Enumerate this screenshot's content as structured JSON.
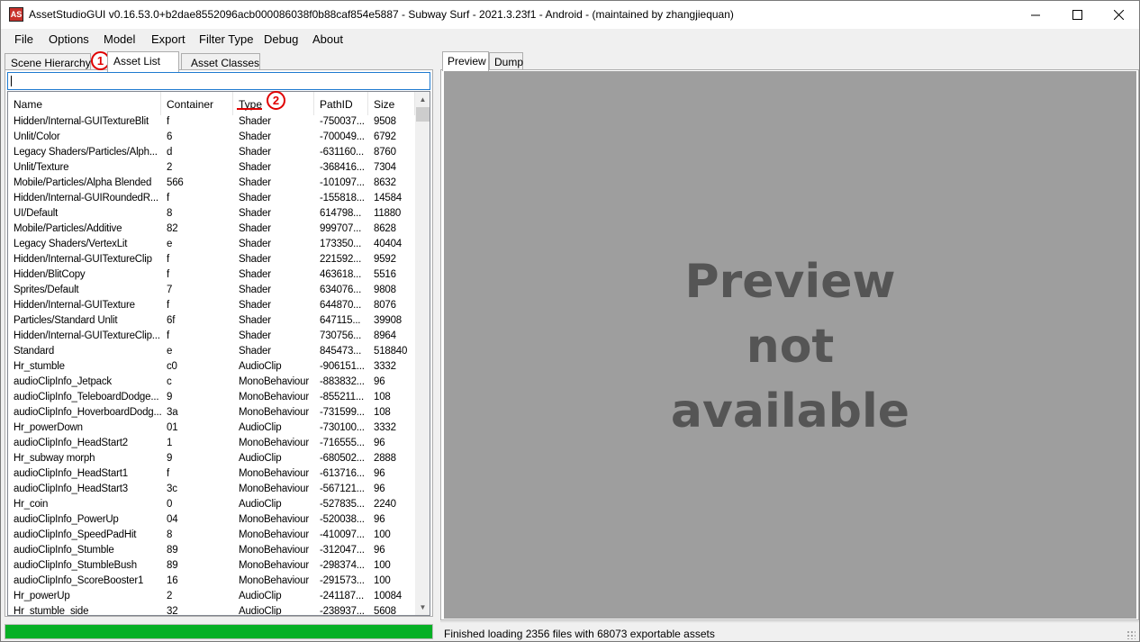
{
  "window": {
    "title": "AssetStudioGUI v0.16.53.0+b2dae8552096acb000086038f0b88caf854e5887 - Subway Surf - 2021.3.23f1 - Android - (maintained by zhangjiequan)",
    "icon_text": "AS"
  },
  "menu": [
    "File",
    "Options",
    "Model",
    "Export",
    "Filter Type",
    "Debug",
    "About"
  ],
  "left_tabs": [
    "Scene Hierarchy",
    "Asset List",
    "Asset Classes"
  ],
  "filter": {
    "value": ""
  },
  "columns": [
    "Name",
    "Container",
    "Type",
    "PathID",
    "Size"
  ],
  "rows": [
    [
      "Hidden/Internal-GUITextureBlit",
      "f",
      "Shader",
      "-750037...",
      "9508"
    ],
    [
      "Unlit/Color",
      "6",
      "Shader",
      "-700049...",
      "6792"
    ],
    [
      "Legacy Shaders/Particles/Alph...",
      "d",
      "Shader",
      "-631160...",
      "8760"
    ],
    [
      "Unlit/Texture",
      "2",
      "Shader",
      "-368416...",
      "7304"
    ],
    [
      "Mobile/Particles/Alpha Blended",
      "566",
      "Shader",
      "-101097...",
      "8632"
    ],
    [
      "Hidden/Internal-GUIRoundedR...",
      "f",
      "Shader",
      "-155818...",
      "14584"
    ],
    [
      "UI/Default",
      "8",
      "Shader",
      "614798...",
      "11880"
    ],
    [
      "Mobile/Particles/Additive",
      "82",
      "Shader",
      "999707...",
      "8628"
    ],
    [
      "Legacy Shaders/VertexLit",
      "e",
      "Shader",
      "173350...",
      "40404"
    ],
    [
      "Hidden/Internal-GUITextureClip",
      "f",
      "Shader",
      "221592...",
      "9592"
    ],
    [
      "Hidden/BlitCopy",
      "f",
      "Shader",
      "463618...",
      "5516"
    ],
    [
      "Sprites/Default",
      "7",
      "Shader",
      "634076...",
      "9808"
    ],
    [
      "Hidden/Internal-GUITexture",
      "f",
      "Shader",
      "644870...",
      "8076"
    ],
    [
      "Particles/Standard Unlit",
      "6f",
      "Shader",
      "647115...",
      "39908"
    ],
    [
      "Hidden/Internal-GUITextureClip...",
      "f",
      "Shader",
      "730756...",
      "8964"
    ],
    [
      "Standard",
      "e",
      "Shader",
      "845473...",
      "518840"
    ],
    [
      "Hr_stumble",
      "c0",
      "AudioClip",
      "-906151...",
      "3332"
    ],
    [
      "audioClipInfo_Jetpack",
      "c",
      "MonoBehaviour",
      "-883832...",
      "96"
    ],
    [
      "audioClipInfo_TeleboardDodge...",
      "9",
      "MonoBehaviour",
      "-855211...",
      "108"
    ],
    [
      "audioClipInfo_HoverboardDodg...",
      "3a",
      "MonoBehaviour",
      "-731599...",
      "108"
    ],
    [
      "Hr_powerDown",
      "01",
      "AudioClip",
      "-730100...",
      "3332"
    ],
    [
      "audioClipInfo_HeadStart2",
      "1",
      "MonoBehaviour",
      "-716555...",
      "96"
    ],
    [
      "Hr_subway morph",
      "9",
      "AudioClip",
      "-680502...",
      "2888"
    ],
    [
      "audioClipInfo_HeadStart1",
      "f",
      "MonoBehaviour",
      "-613716...",
      "96"
    ],
    [
      "audioClipInfo_HeadStart3",
      "3c",
      "MonoBehaviour",
      "-567121...",
      "96"
    ],
    [
      "Hr_coin",
      "0",
      "AudioClip",
      "-527835...",
      "2240"
    ],
    [
      "audioClipInfo_PowerUp",
      "04",
      "MonoBehaviour",
      "-520038...",
      "96"
    ],
    [
      "audioClipInfo_SpeedPadHit",
      "8",
      "MonoBehaviour",
      "-410097...",
      "100"
    ],
    [
      "audioClipInfo_Stumble",
      "89",
      "MonoBehaviour",
      "-312047...",
      "96"
    ],
    [
      "audioClipInfo_StumbleBush",
      "89",
      "MonoBehaviour",
      "-298374...",
      "100"
    ],
    [
      "audioClipInfo_ScoreBooster1",
      "16",
      "MonoBehaviour",
      "-291573...",
      "100"
    ],
    [
      "Hr_powerUp",
      "2",
      "AudioClip",
      "-241187...",
      "10084"
    ],
    [
      "Hr_stumble_side",
      "32",
      "AudioClip",
      "-238937...",
      "5608"
    ]
  ],
  "progress": {
    "percent": 100,
    "color": "#06b025"
  },
  "right_tabs": [
    "Preview",
    "Dump"
  ],
  "preview": {
    "line1": "Preview",
    "line2": "not",
    "line3": "available"
  },
  "status": "Finished loading 2356 files with 68073 exportable assets",
  "annotations": {
    "marker1": "1",
    "marker2": "2",
    "color": "#e00000"
  }
}
